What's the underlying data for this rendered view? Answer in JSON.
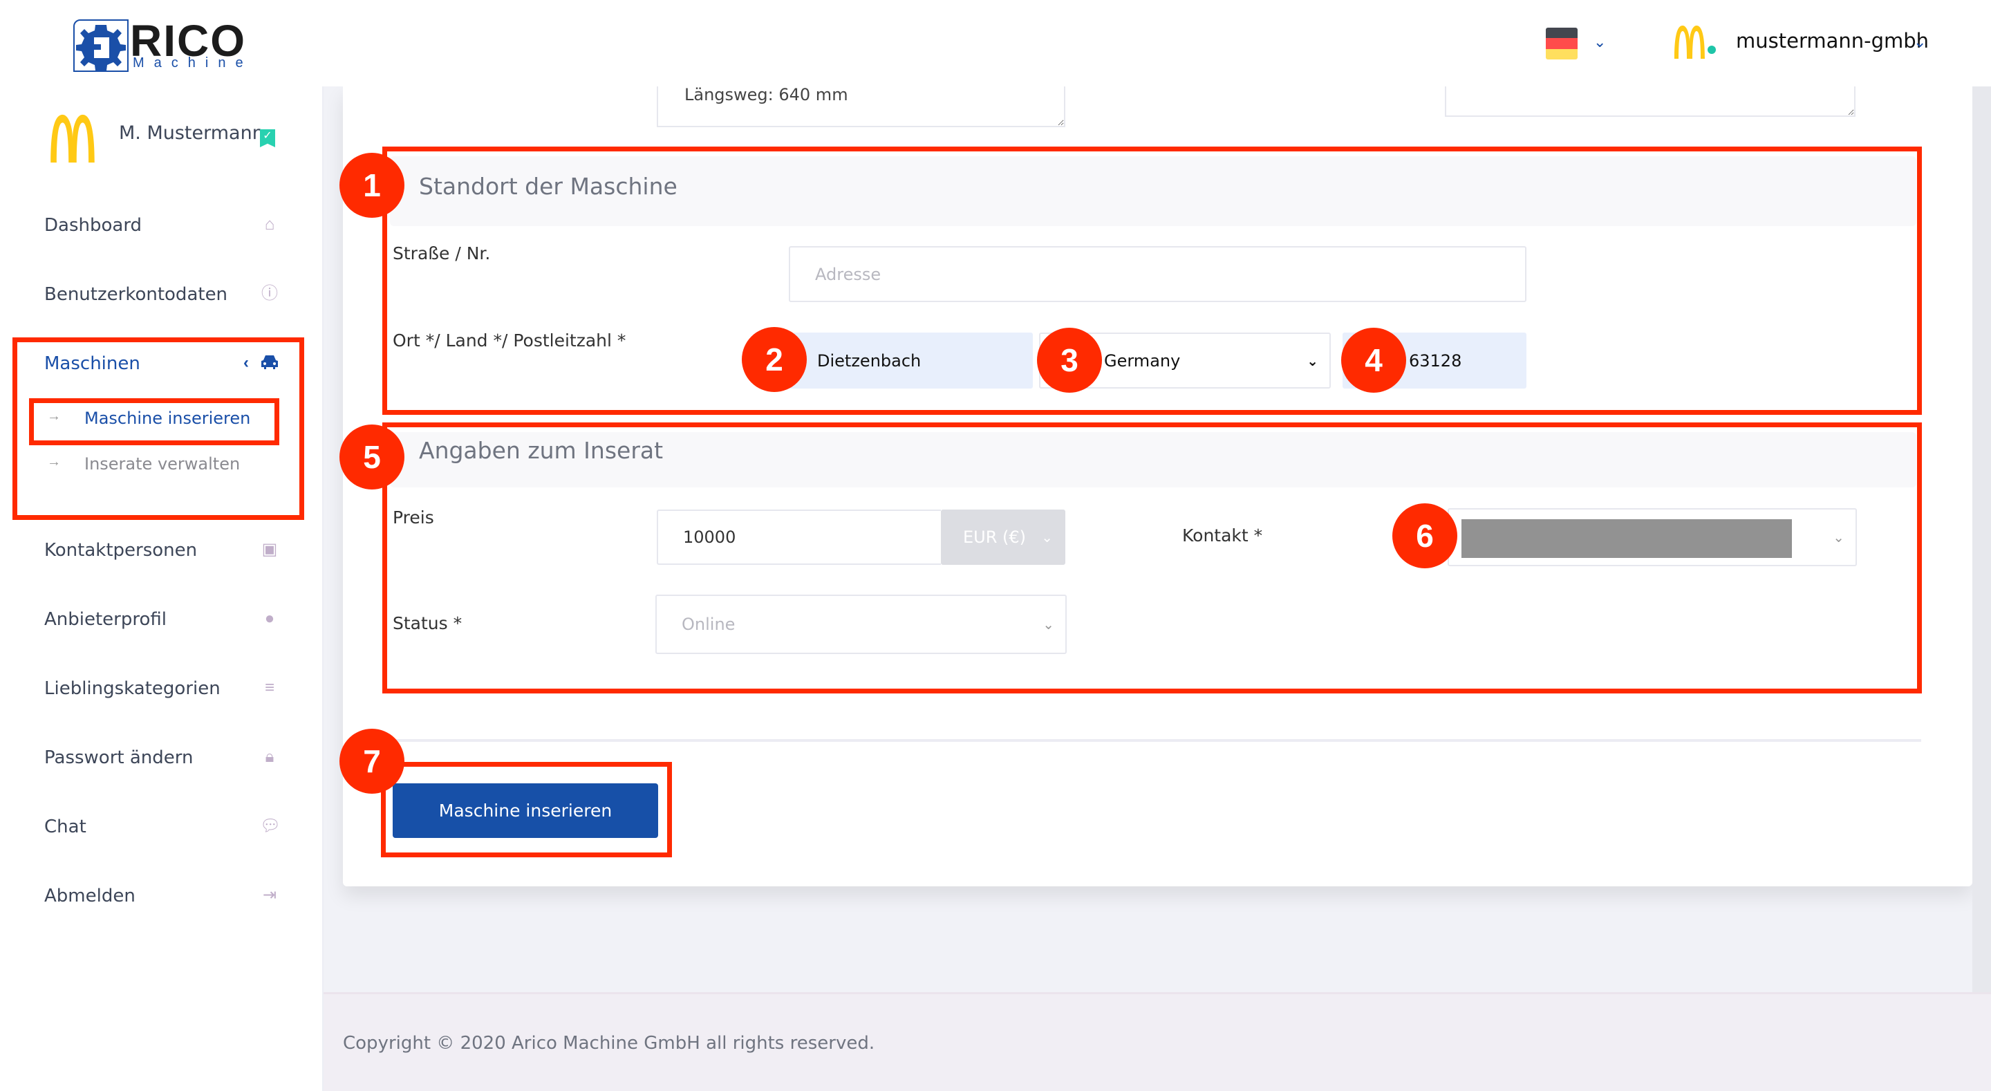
{
  "header": {
    "logo_text": "RICO",
    "logo_subtext": "Machine",
    "language_flag": "flag-germany-icon",
    "company_name": "mustermann-gmbh"
  },
  "sidebar": {
    "user_name": "M. Mustermann",
    "items": [
      {
        "label": "Dashboard",
        "icon": "home-icon"
      },
      {
        "label": "Benutzerkontodaten",
        "icon": "info-icon"
      },
      {
        "label": "Maschinen",
        "icon": "car-icon",
        "active": true,
        "subitems": [
          {
            "label": "Maschine inserieren",
            "active": true
          },
          {
            "label": "Inserate verwalten"
          }
        ]
      },
      {
        "label": "Kontaktpersonen",
        "icon": "contact-card-icon"
      },
      {
        "label": "Anbieterprofil",
        "icon": "user-icon"
      },
      {
        "label": "Lieblingskategorien",
        "icon": "list-icon"
      },
      {
        "label": "Passwort ändern",
        "icon": "lock-icon"
      },
      {
        "label": "Chat",
        "icon": "chat-icon"
      },
      {
        "label": "Abmelden",
        "icon": "logout-icon"
      }
    ]
  },
  "form": {
    "description_textarea_value": "Längsweg: 640 mm",
    "location": {
      "title": "Standort der Maschine",
      "street_label": "Straße / Nr.",
      "street_placeholder": "Adresse",
      "city_country_zip_label": "Ort */ Land */ Postleitzahl *",
      "city_value": "Dietzenbach",
      "country_value": "Germany",
      "zip_value": "63128"
    },
    "listing": {
      "title": "Angaben zum Inserat",
      "price_label": "Preis",
      "price_value": "10000",
      "currency_value": "EUR (€)",
      "contact_label": "Kontakt *",
      "contact_value": "",
      "status_label": "Status *",
      "status_value": "Online"
    },
    "submit_label": "Maschine inserieren"
  },
  "annotations": [
    "1",
    "2",
    "3",
    "4",
    "5",
    "6",
    "7"
  ],
  "footer": {
    "copyright": "Copyright © 2020  Arico Machine GmbH all rights reserved."
  },
  "colors": {
    "brand_blue": "#1750a8",
    "annotation_red": "#ff2a00",
    "filled_input_bg": "#e8effc",
    "icon_muted": "#c0aec9",
    "verified_teal": "#28d1b0"
  }
}
